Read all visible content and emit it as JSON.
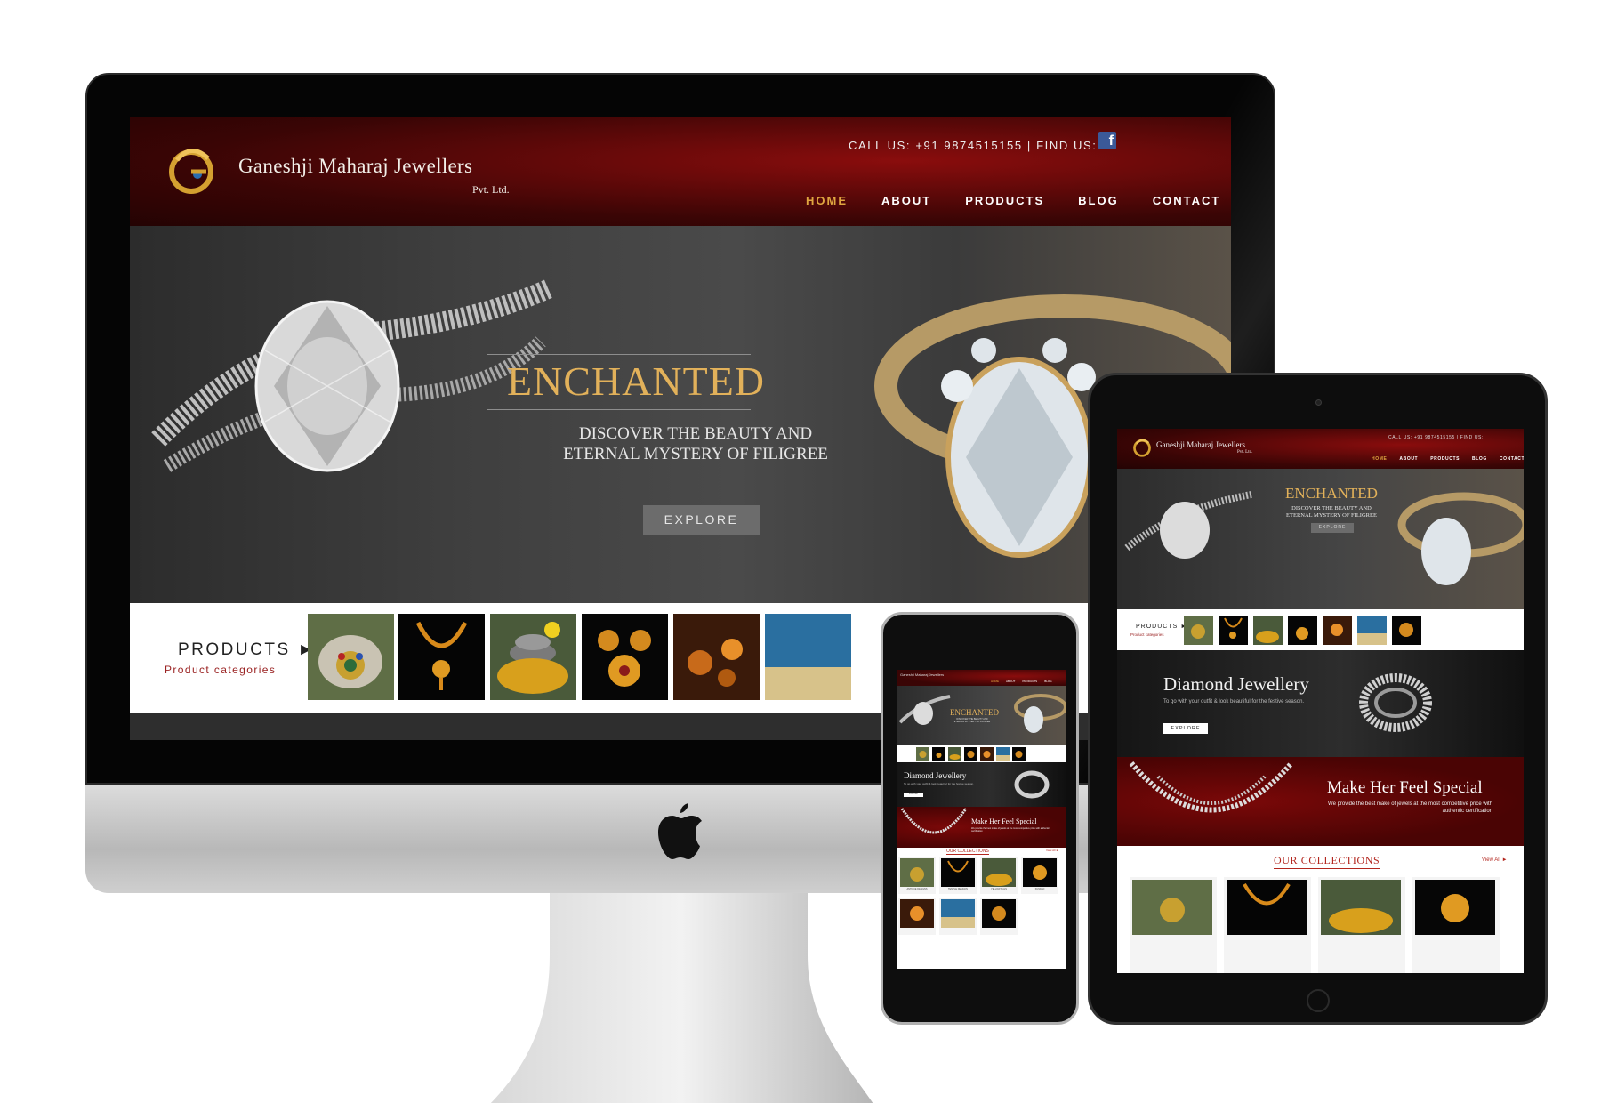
{
  "site": {
    "brand": "Ganeshji Maharaj Jewellers",
    "brand_sub": "Pvt. Ltd.",
    "contact_line": "CALL US: +91 9874515155 | FIND US:",
    "social_icon": "facebook-icon",
    "nav": [
      "HOME",
      "ABOUT",
      "PRODUCTS",
      "BLOG",
      "CONTACT"
    ],
    "active_nav": "HOME"
  },
  "hero": {
    "title": "ENCHANTED",
    "subtitle_line1": "DISCOVER THE BEAUTY AND",
    "subtitle_line2": "ETERNAL MYSTERY OF FILIGREE",
    "button": "EXPLORE"
  },
  "products": {
    "label": "PRODUCTS",
    "arrow": "►",
    "sub": "Product categories"
  },
  "banners": {
    "diamond_title": "Diamond Jewellery",
    "diamond_sub": "To go with your outfit & look beautiful for the festive season.",
    "diamond_button": "EXPLORE",
    "special_title": "Make Her Feel Special",
    "special_sub": "We provide the best make of jewels at the most competitive price with authentic certification"
  },
  "collections": {
    "title": "OUR COLLECTIONS",
    "view_all": "View All ►",
    "labels": [
      "ANTIQUE DESIGNS",
      "TEMPLE DESIGNS",
      "YELLOW MALS",
      "KUNDAN"
    ]
  },
  "colors": {
    "brand_red": "#5a0606",
    "gold": "#e2b15a",
    "nav_active": "#e0a640",
    "accent_red": "#b3261e"
  },
  "device_marks": {
    "imac_logo": "apple-logo-icon"
  }
}
